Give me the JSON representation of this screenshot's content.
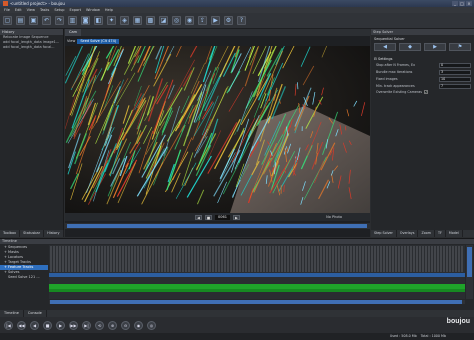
{
  "app": {
    "title": "<untitled project> - boujou",
    "window_controls": [
      "_",
      "□",
      "×"
    ],
    "brand": "boujou"
  },
  "menu": [
    "File",
    "Edit",
    "View",
    "Tasks",
    "Setup",
    "Export",
    "Window",
    "Help"
  ],
  "toolbar": {
    "buttons": [
      {
        "name": "new-icon",
        "glyph": "▢"
      },
      {
        "name": "open-icon",
        "glyph": "▤"
      },
      {
        "name": "save-icon",
        "glyph": "▣"
      },
      {
        "name": "undo-icon",
        "glyph": "↶"
      },
      {
        "name": "redo-icon",
        "glyph": "↷"
      },
      {
        "name": "import-sequence-icon",
        "glyph": "▥"
      },
      {
        "name": "camera-icon",
        "glyph": "◙"
      },
      {
        "name": "mask-icon",
        "glyph": "◧"
      },
      {
        "name": "track-icon",
        "glyph": "✦"
      },
      {
        "name": "solve-icon",
        "glyph": "◈"
      },
      {
        "name": "grid-icon",
        "glyph": "▦"
      },
      {
        "name": "scene-icon",
        "glyph": "▩"
      },
      {
        "name": "lock-icon",
        "glyph": "◪"
      },
      {
        "name": "target-icon",
        "glyph": "◎"
      },
      {
        "name": "lens-icon",
        "glyph": "◉"
      },
      {
        "name": "export-icon",
        "glyph": "⇪"
      },
      {
        "name": "render-icon",
        "glyph": "▶"
      },
      {
        "name": "settings-icon",
        "glyph": "⚙"
      },
      {
        "name": "help-icon",
        "glyph": "?"
      }
    ]
  },
  "left_panel": {
    "header": "History",
    "lines": [
      "Relocate Image Sequence",
      "add focal_length_data image1...",
      "add focal_length_data focal..."
    ],
    "tabs": [
      "Toolbox",
      "Statusbar",
      "History"
    ]
  },
  "viewer": {
    "tab": "Cam",
    "view_label": "View",
    "camera_select": "Seed Solve (Clt 474)",
    "frame": "0061",
    "no_photo": "No Photo",
    "playback": [
      "◀",
      "■",
      "▶"
    ]
  },
  "right_panel": {
    "title": "Step Solver",
    "subtitle": "Sequential Solver",
    "buttons": [
      "◀",
      "◆",
      "▶",
      "⚑"
    ],
    "section": "Settings",
    "rows": [
      {
        "label": "Stop after N Frames, Ex",
        "value": "0"
      },
      {
        "label": "Bundle max iterations",
        "value": "3"
      },
      {
        "label": "Fixed images",
        "value": "10"
      },
      {
        "label": "Min. track appearances",
        "value": "7"
      }
    ],
    "checkbox_label": "Overwrite Existing Cameras",
    "tabs": [
      "Step Solver",
      "Overlays",
      "Zoom",
      "TF",
      "Model"
    ]
  },
  "timeline": {
    "header": "Timeline",
    "items": [
      {
        "label": "Sequences",
        "sub": false,
        "selected": false
      },
      {
        "label": "Masks",
        "sub": false,
        "selected": false
      },
      {
        "label": "Locators",
        "sub": false,
        "selected": false
      },
      {
        "label": "Target Tracks",
        "sub": false,
        "selected": false
      },
      {
        "label": "Feature Tracks",
        "sub": false,
        "selected": true
      },
      {
        "label": "Solves",
        "sub": false,
        "selected": false
      },
      {
        "label": "Seed Solve 121 ...",
        "sub": true,
        "selected": false
      }
    ]
  },
  "bottom_tabs": [
    "Timeline",
    "Console"
  ],
  "transport": [
    "|◀",
    "◀◀",
    "◀",
    "■",
    "▶",
    "▶▶",
    "▶|",
    "⟲",
    "⊕",
    "⊖",
    "◉",
    "◎"
  ],
  "status": {
    "used": "Used : 508.0 Mb",
    "total": "Total : 1000 Mb"
  },
  "colors": {
    "selection": "#2e6fbf",
    "scrollbar": "#3f6fb4",
    "timeline_green": "#1fa32a",
    "timeline_blue": "#2c5ea0"
  }
}
